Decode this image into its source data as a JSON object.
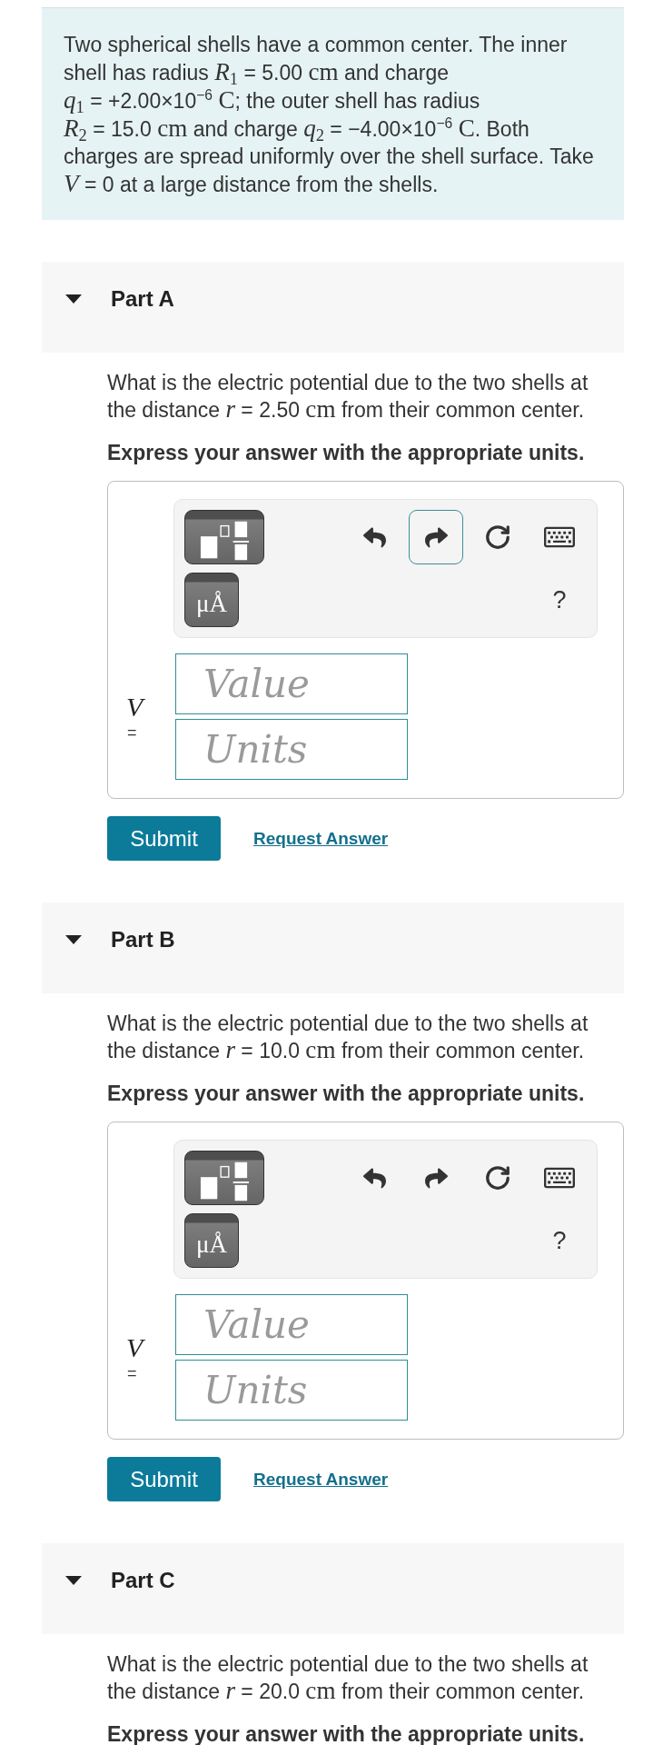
{
  "problem": {
    "segments": [
      {
        "kind": "text",
        "text": "Two spherical shells have a common center. The inner shell has radius "
      },
      {
        "kind": "expr",
        "parts": [
          {
            "kind": "math",
            "text": "*R*$_{1}$"
          },
          {
            "kind": "text",
            "text": " = 5.00 "
          },
          {
            "kind": "math",
            "text": "cm"
          }
        ]
      },
      {
        "kind": "text",
        "text": " and charge "
      },
      {
        "kind": "expr",
        "parts": [
          {
            "kind": "math",
            "text": "*q*$_{1}$"
          },
          {
            "kind": "text",
            "text": " = +2.00×10$^{−6}$ "
          },
          {
            "kind": "math",
            "text": "C"
          }
        ]
      },
      {
        "kind": "text",
        "text": "; the outer shell has radius "
      },
      {
        "kind": "expr",
        "parts": [
          {
            "kind": "math",
            "text": "*R*$_{2}$"
          },
          {
            "kind": "text",
            "text": " = 15.0 "
          },
          {
            "kind": "math",
            "text": "cm"
          }
        ]
      },
      {
        "kind": "text",
        "text": " and charge "
      },
      {
        "kind": "expr",
        "parts": [
          {
            "kind": "math",
            "text": "*q*$_{2}$"
          },
          {
            "kind": "text",
            "text": " = −4.00×10$^{−6}$ "
          },
          {
            "kind": "math",
            "text": "C"
          }
        ]
      },
      {
        "kind": "text",
        "text": ". Both charges are spread uniformly over the shell surface. Take "
      },
      {
        "kind": "expr",
        "parts": [
          {
            "kind": "math",
            "text": "*V*"
          },
          {
            "kind": "text",
            "text": " = 0"
          }
        ]
      },
      {
        "kind": "text",
        "text": " at a large distance from the shells."
      }
    ]
  },
  "parts": [
    {
      "title": "Part A",
      "expanded": true,
      "question": {
        "segments": [
          {
            "kind": "text",
            "text": "What is the electric potential due to the two shells at the distance "
          },
          {
            "kind": "expr",
            "parts": [
              {
                "kind": "math",
                "text": "*r*"
              },
              {
                "kind": "text",
                "text": " = 2.50 "
              },
              {
                "kind": "math",
                "text": "cm"
              }
            ]
          },
          {
            "kind": "text",
            "text": " from their common center."
          }
        ]
      },
      "instruction": "Express your answer with the appropriate units.",
      "answer": {
        "toolbar": {
          "units_button": "μÅ",
          "tools": [
            {
              "kind": "undo",
              "focused": false
            },
            {
              "kind": "redo",
              "focused": true
            },
            {
              "kind": "reset",
              "focused": false
            },
            {
              "kind": "keyboard",
              "focused": false
            }
          ],
          "help": "?"
        },
        "variable": "V",
        "equals": "=",
        "value": {
          "placeholder": "Value"
        },
        "units": {
          "placeholder": "Units"
        }
      },
      "submit": "Submit",
      "request_answer": "Request Answer"
    },
    {
      "title": "Part B",
      "expanded": true,
      "question": {
        "segments": [
          {
            "kind": "text",
            "text": "What is the electric potential due to the two shells at the distance "
          },
          {
            "kind": "expr",
            "parts": [
              {
                "kind": "math",
                "text": "*r*"
              },
              {
                "kind": "text",
                "text": " = 10.0 "
              },
              {
                "kind": "math",
                "text": "cm"
              }
            ]
          },
          {
            "kind": "text",
            "text": " from their common center."
          }
        ]
      },
      "instruction": "Express your answer with the appropriate units.",
      "answer": {
        "toolbar": {
          "units_button": "μÅ",
          "tools": [
            {
              "kind": "undo",
              "focused": false
            },
            {
              "kind": "redo",
              "focused": false
            },
            {
              "kind": "reset",
              "focused": false
            },
            {
              "kind": "keyboard",
              "focused": false
            }
          ],
          "help": "?"
        },
        "variable": "V",
        "equals": "=",
        "value": {
          "placeholder": "Value"
        },
        "units": {
          "placeholder": "Units"
        }
      },
      "submit": "Submit",
      "request_answer": "Request Answer"
    },
    {
      "title": "Part C",
      "expanded": true,
      "question": {
        "segments": [
          {
            "kind": "text",
            "text": "What is the electric potential due to the two shells at the distance "
          },
          {
            "kind": "expr",
            "parts": [
              {
                "kind": "math",
                "text": "*r*"
              },
              {
                "kind": "text",
                "text": " = 20.0 "
              },
              {
                "kind": "math",
                "text": "cm"
              }
            ]
          },
          {
            "kind": "text",
            "text": " from their common center."
          }
        ]
      },
      "instruction": "Express your answer with the appropriate units."
    }
  ]
}
